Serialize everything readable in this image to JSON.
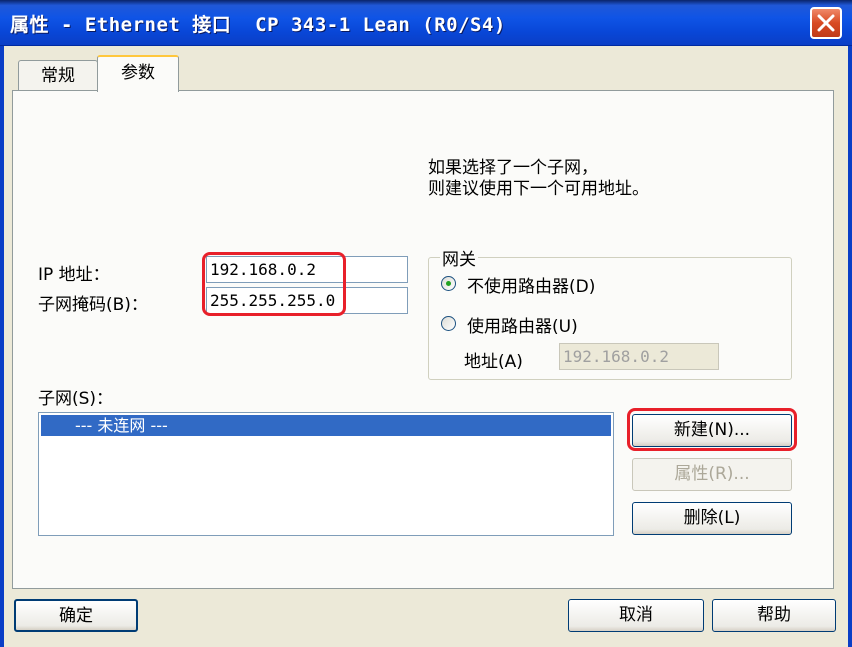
{
  "window": {
    "title": "属性 - Ethernet 接口  CP 343-1 Lean (R0/S4)"
  },
  "tabs": [
    {
      "label": "常规"
    },
    {
      "label": "参数"
    }
  ],
  "hint": {
    "line1": "如果选择了一个子网，",
    "line2": "则建议使用下一个可用地址。"
  },
  "ip": {
    "label": "IP 地址：",
    "value": "192.168.0.2"
  },
  "subnet_mask": {
    "label": "子网掩码(B)：",
    "value": "255.255.255.0"
  },
  "gateway": {
    "title": "网关",
    "option_no_router": "不使用路由器(D)",
    "option_use_router": "使用路由器(U)",
    "address_label": "地址(A)",
    "address_value": "192.168.0.2",
    "selected": "no_router"
  },
  "subnet": {
    "label": "子网(S)：",
    "items": [
      "--- 未连网 ---"
    ]
  },
  "side_buttons": {
    "new": "新建(N)...",
    "properties": "属性(R)...",
    "delete": "删除(L)"
  },
  "footer": {
    "ok": "确定",
    "cancel": "取消",
    "help": "帮助"
  },
  "colors": {
    "highlight": "#e8202a",
    "selection": "#316ac5"
  }
}
